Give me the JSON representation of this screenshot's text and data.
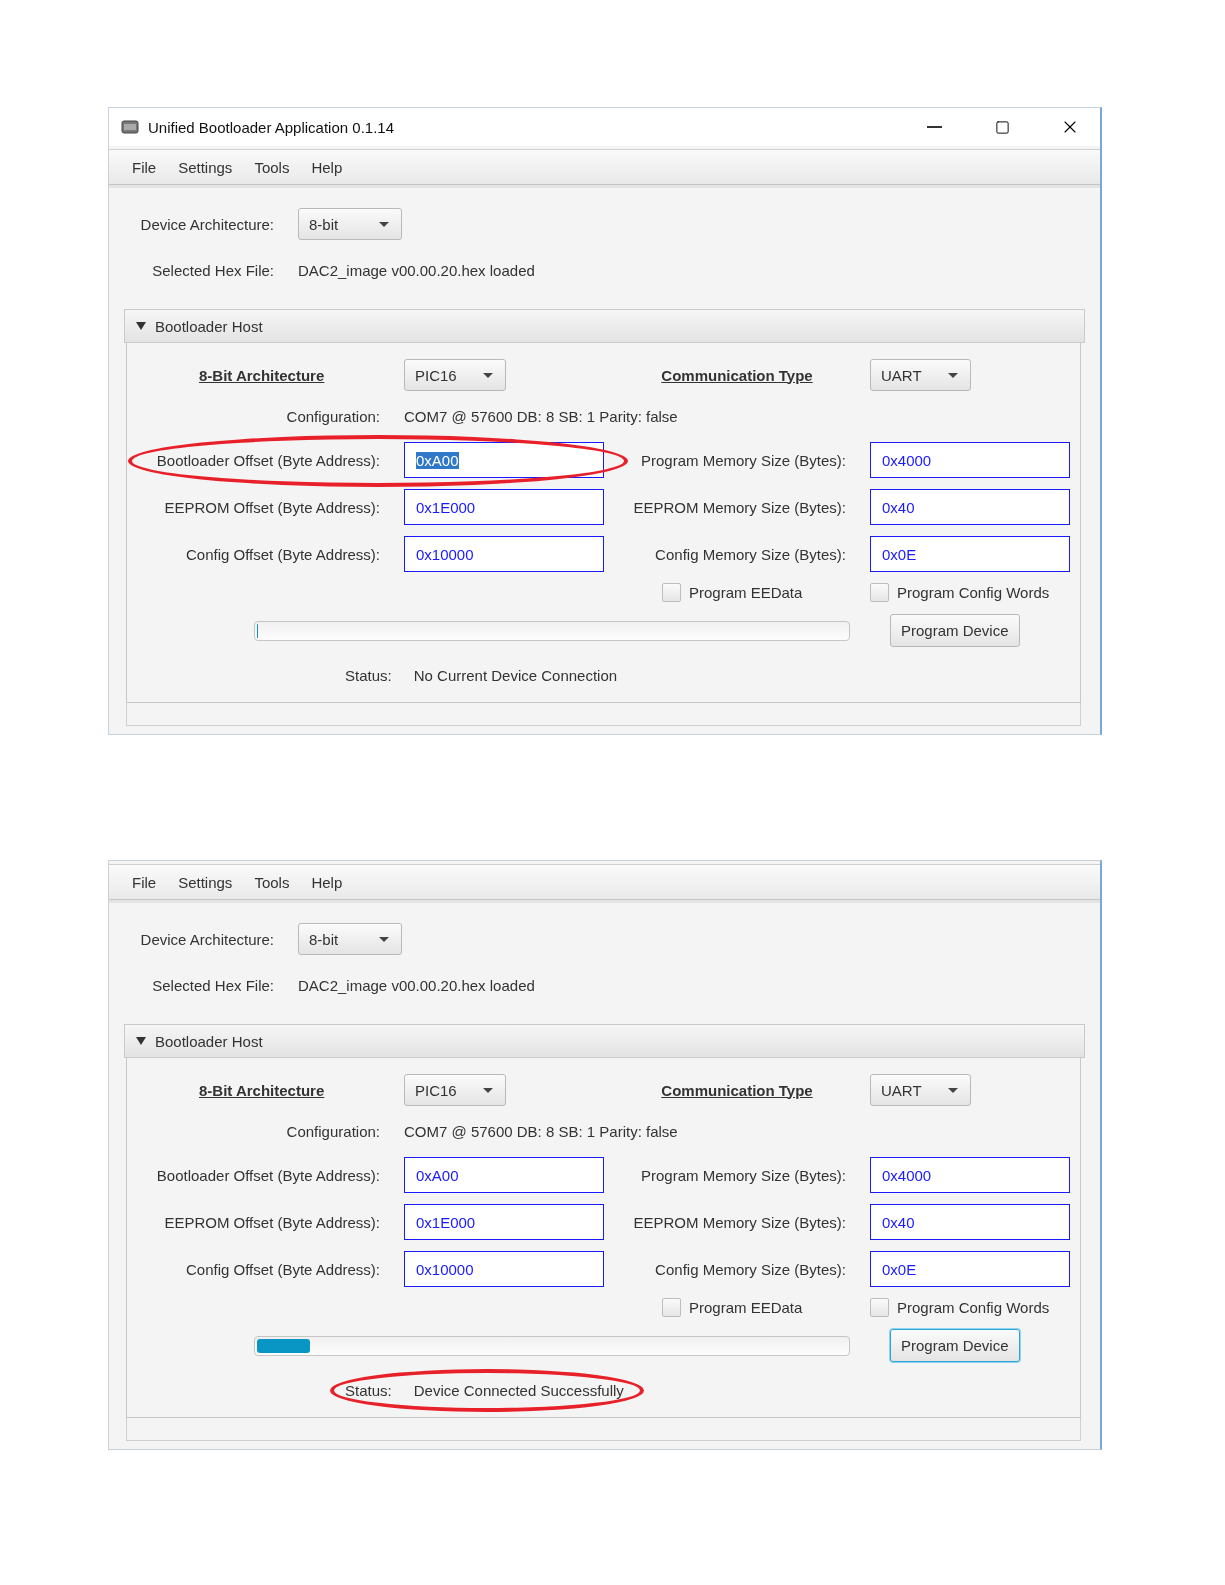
{
  "panels": [
    {
      "window": {
        "title": "Unified Bootloader Application 0.1.14"
      },
      "menu": [
        "File",
        "Settings",
        "Tools",
        "Help"
      ],
      "device_architecture": {
        "label": "Device Architecture:",
        "value": "8-bit"
      },
      "hex_file": {
        "label": "Selected Hex File:",
        "value": "DAC2_image v00.00.20.hex loaded"
      },
      "section": {
        "title": "Bootloader Host",
        "expanded": true
      },
      "architecture": {
        "heading": "8-Bit Architecture",
        "value": "PIC16"
      },
      "communication": {
        "heading": "Communication Type",
        "value": "UART"
      },
      "configuration": {
        "label": "Configuration:",
        "value": "COM7 @ 57600 DB: 8 SB: 1 Parity: false"
      },
      "fields": [
        {
          "label": "Bootloader Offset (Byte Address):",
          "value": "0xA00",
          "selected": true,
          "circled": true
        },
        {
          "label": "Program Memory Size (Bytes):",
          "value": "0x4000",
          "selected": false,
          "circled": false
        },
        {
          "label": "EEPROM Offset (Byte Address):",
          "value": "0x1E000",
          "selected": false,
          "circled": false
        },
        {
          "label": "EEPROM Memory Size (Bytes):",
          "value": "0x40",
          "selected": false,
          "circled": false
        },
        {
          "label": "Config Offset (Byte Address):",
          "value": "0x10000",
          "selected": false,
          "circled": false
        },
        {
          "label": "Config Memory Size (Bytes):",
          "value": "0x0E",
          "selected": false,
          "circled": false
        }
      ],
      "checkboxes": [
        {
          "label": "Program EEData",
          "checked": false
        },
        {
          "label": "Program Config Words",
          "checked": false
        }
      ],
      "progress": {
        "level": 0
      },
      "program_button": {
        "label": "Program Device",
        "focused": false
      },
      "status": {
        "label": "Status:",
        "value": "No Current Device Connection",
        "circled": false
      }
    },
    {
      "menu": [
        "File",
        "Settings",
        "Tools",
        "Help"
      ],
      "device_architecture": {
        "label": "Device Architecture:",
        "value": "8-bit"
      },
      "hex_file": {
        "label": "Selected Hex File:",
        "value": "DAC2_image v00.00.20.hex loaded"
      },
      "section": {
        "title": "Bootloader Host",
        "expanded": true
      },
      "architecture": {
        "heading": "8-Bit Architecture",
        "value": "PIC16"
      },
      "communication": {
        "heading": "Communication Type",
        "value": "UART"
      },
      "configuration": {
        "label": "Configuration:",
        "value": "COM7 @ 57600 DB: 8 SB: 1 Parity: false"
      },
      "fields": [
        {
          "label": "Bootloader Offset (Byte Address):",
          "value": "0xA00",
          "selected": false,
          "circled": false
        },
        {
          "label": "Program Memory Size (Bytes):",
          "value": "0x4000",
          "selected": false,
          "circled": false
        },
        {
          "label": "EEPROM Offset (Byte Address):",
          "value": "0x1E000",
          "selected": false,
          "circled": false
        },
        {
          "label": "EEPROM Memory Size (Bytes):",
          "value": "0x40",
          "selected": false,
          "circled": false
        },
        {
          "label": "Config Offset (Byte Address):",
          "value": "0x10000",
          "selected": false,
          "circled": false
        },
        {
          "label": "Config Memory Size (Bytes):",
          "value": "0x0E",
          "selected": false,
          "circled": false
        }
      ],
      "checkboxes": [
        {
          "label": "Program EEData",
          "checked": false
        },
        {
          "label": "Program Config Words",
          "checked": false
        }
      ],
      "progress": {
        "level": 0.09
      },
      "program_button": {
        "label": "Program Device",
        "focused": true
      },
      "status": {
        "label": "Status:",
        "value": "Device Connected Successfully",
        "circled": true
      }
    }
  ]
}
